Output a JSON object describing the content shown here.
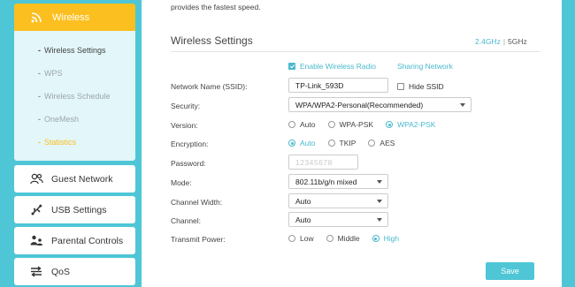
{
  "sidebar": {
    "wireless_label": "Wireless",
    "submenu": [
      {
        "label": "Wireless Settings"
      },
      {
        "label": "WPS"
      },
      {
        "label": "Wireless Schedule"
      },
      {
        "label": "OneMesh"
      },
      {
        "label": "Statistics"
      }
    ],
    "items": [
      {
        "label": "Guest Network",
        "icon": "guest-network-icon"
      },
      {
        "label": "USB Settings",
        "icon": "usb-icon"
      },
      {
        "label": "Parental Controls",
        "icon": "parental-controls-icon"
      },
      {
        "label": "QoS",
        "icon": "qos-icon"
      }
    ],
    "active_color": "#fbbf1f"
  },
  "main": {
    "intro_text": "provides the fastest speed.",
    "section_title": "Wireless Settings",
    "band_24": "2.4GHz",
    "band_sep": "|",
    "band_5": "5GHz",
    "enable_radio_label": "Enable Wireless Radio",
    "enable_radio_checked": true,
    "sharing_network_label": "Sharing Network",
    "ssid_label": "Network Name (SSID):",
    "ssid_value": "TP-Link_593D",
    "hide_ssid_label": "Hide SSID",
    "hide_ssid_checked": false,
    "security_label": "Security:",
    "security_value": "WPA/WPA2-Personal(Recommended)",
    "version_label": "Version:",
    "version_options": [
      "Auto",
      "WPA-PSK",
      "WPA2-PSK"
    ],
    "version_selected": "WPA2-PSK",
    "encryption_label": "Encryption:",
    "encryption_options": [
      "Auto",
      "TKIP",
      "AES"
    ],
    "encryption_selected": "Auto",
    "password_label": "Password:",
    "password_value": "12345678",
    "mode_label": "Mode:",
    "mode_value": "802.11b/g/n mixed",
    "channel_width_label": "Channel Width:",
    "channel_width_value": "Auto",
    "channel_label": "Channel:",
    "channel_value": "Auto",
    "transmit_power_label": "Transmit Power:",
    "transmit_power_options": [
      "Low",
      "Middle",
      "High"
    ],
    "transmit_power_selected": "High",
    "save_label": "Save"
  },
  "colors": {
    "background": "#4ec6d6",
    "accent": "#4ab9cc",
    "active_nav": "#fbbf1f"
  }
}
